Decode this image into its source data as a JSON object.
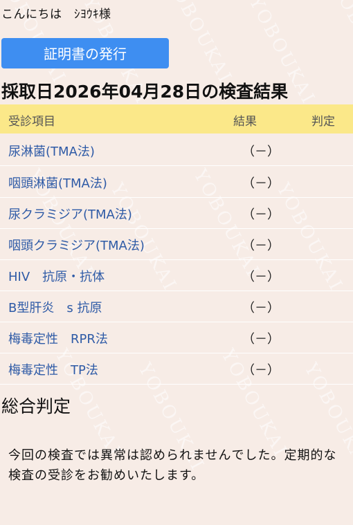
{
  "greeting": "こんにちは　ｼﾖｳｷ様",
  "certificate_button_label": "証明書の発行",
  "date_title": "採取日2026年04月28日の検査結果",
  "table": {
    "headers": {
      "item": "受診項目",
      "result": "結果",
      "judgment": "判定"
    },
    "rows": [
      {
        "item": "尿淋菌(TMA法)",
        "result": "（－）"
      },
      {
        "item": "咽頭淋菌(TMA法)",
        "result": "（－）"
      },
      {
        "item": "尿クラミジア(TMA法)",
        "result": "（－）"
      },
      {
        "item": "咽頭クラミジア(TMA法)",
        "result": "（－）"
      },
      {
        "item": "HIV　抗原・抗体",
        "result": "（－）"
      },
      {
        "item": "B型肝炎　s 抗原",
        "result": "（－）"
      },
      {
        "item": "梅毒定性　RPR法",
        "result": "（－）"
      },
      {
        "item": "梅毒定性　TP法",
        "result": "（－）"
      }
    ]
  },
  "overall": {
    "title": "総合判定",
    "text": "今回の検査では異常は認められませんでした。定期的な検査の受診をお勧めいたします。"
  },
  "watermark_text": "YOBOUKAI",
  "colors": {
    "button": "#3e8ef1",
    "header": "#fbe889",
    "item_text": "#2e5aa6",
    "background": "#f7ece6"
  }
}
